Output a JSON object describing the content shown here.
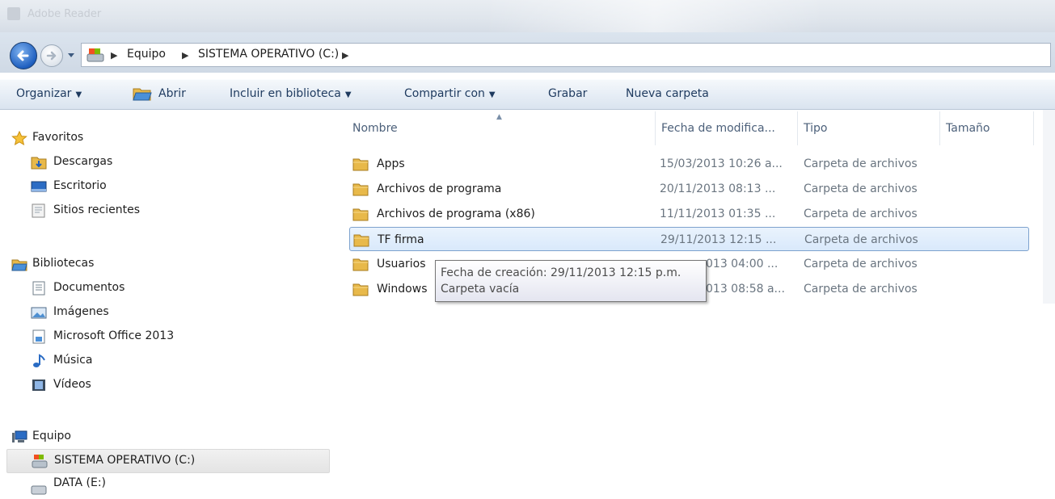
{
  "window": {
    "title": "Adobe Reader"
  },
  "address": {
    "breadcrumb": [
      "Equipo",
      "SISTEMA OPERATIVO (C:)"
    ]
  },
  "toolbar": {
    "organize": "Organizar",
    "open": "Abrir",
    "include_library": "Incluir en biblioteca",
    "share": "Compartir con",
    "burn": "Grabar",
    "new_folder": "Nueva carpeta"
  },
  "sidebar": {
    "favorites": {
      "label": "Favoritos",
      "items": [
        {
          "label": "Descargas",
          "icon": "downloads-icon"
        },
        {
          "label": "Escritorio",
          "icon": "desktop-icon"
        },
        {
          "label": "Sitios recientes",
          "icon": "recent-places-icon"
        }
      ]
    },
    "libraries": {
      "label": "Bibliotecas",
      "items": [
        {
          "label": "Documentos",
          "icon": "documents-icon"
        },
        {
          "label": "Imágenes",
          "icon": "pictures-icon"
        },
        {
          "label": "Microsoft Office 2013",
          "icon": "office-library-icon"
        },
        {
          "label": "Música",
          "icon": "music-icon"
        },
        {
          "label": "Vídeos",
          "icon": "videos-icon"
        }
      ]
    },
    "computer": {
      "label": "Equipo",
      "items": [
        {
          "label": "SISTEMA OPERATIVO (C:)",
          "icon": "system-drive-icon",
          "selected": true
        },
        {
          "label": "DATA (E:)",
          "icon": "data-drive-icon"
        }
      ]
    }
  },
  "columns": {
    "name": "Nombre",
    "date": "Fecha de modifica...",
    "type": "Tipo",
    "size": "Tamaño"
  },
  "files": [
    {
      "name": "Apps",
      "date": "15/03/2013 10:26 a...",
      "type": "Carpeta de archivos"
    },
    {
      "name": "Archivos de programa",
      "date": "20/11/2013 08:13 ...",
      "type": "Carpeta de archivos"
    },
    {
      "name": "Archivos de programa (x86)",
      "date": "11/11/2013 01:35 ...",
      "type": "Carpeta de archivos"
    },
    {
      "name": "TF firma",
      "date": "29/11/2013 12:15 ...",
      "type": "Carpeta de archivos",
      "selected": true
    },
    {
      "name": "Usuarios",
      "date": "013 04:00 ...",
      "type": "Carpeta de archivos"
    },
    {
      "name": "Windows",
      "date": "013 08:58 a...",
      "type": "Carpeta de archivos"
    }
  ],
  "tooltip": {
    "line1": "Fecha de creación: 29/11/2013 12:15 p.m.",
    "line2": "Carpeta vacía"
  },
  "colors": {
    "accent": "#1f5fbf",
    "selection_border": "#7da2ce",
    "folder": "#e8b94a"
  }
}
